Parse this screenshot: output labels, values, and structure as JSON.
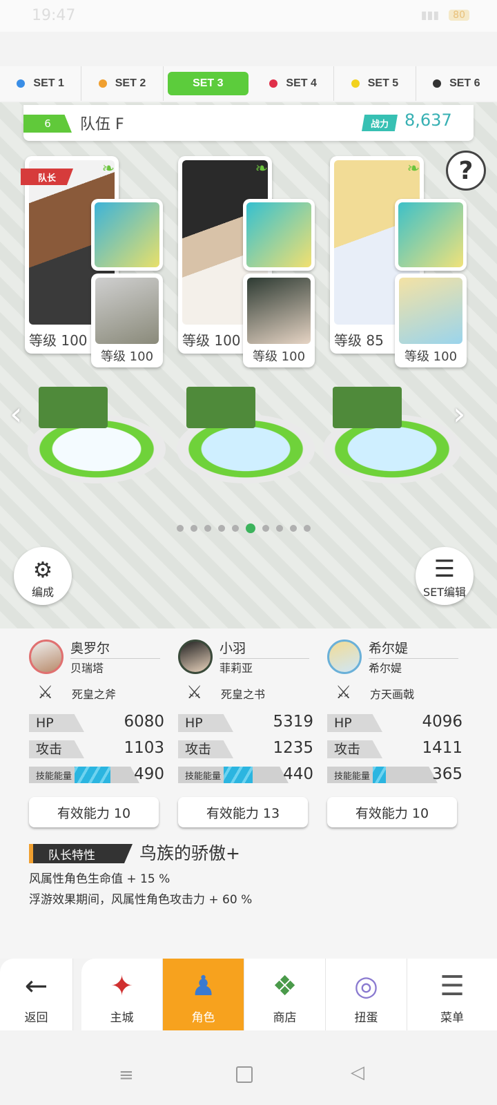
{
  "status_bar": {
    "time": "19:47",
    "battery": "80"
  },
  "set_tabs": [
    {
      "label": "SET 1",
      "color": "#3a8ee6",
      "active": false
    },
    {
      "label": "SET 2",
      "color": "#f0a030",
      "active": false
    },
    {
      "label": "SET 3",
      "color": "#5ccc3c",
      "active": true
    },
    {
      "label": "SET 4",
      "color": "#e0304a",
      "active": false
    },
    {
      "label": "SET 5",
      "color": "#f2d21e",
      "active": false
    },
    {
      "label": "SET 6",
      "color": "#333333",
      "active": false
    }
  ],
  "team": {
    "number": "6",
    "name": "队伍 F",
    "power_label": "战力",
    "power_value": "8,637"
  },
  "captain_badge": "队长",
  "help": "?",
  "slots": [
    {
      "main_level": "等级 100",
      "support_level": "等级 100"
    },
    {
      "main_level": "等级 100",
      "support_level": "等级 100"
    },
    {
      "main_level": "等级 85",
      "support_level": "等级 100"
    }
  ],
  "page_dots": {
    "count": 10,
    "active_index": 5
  },
  "formation_button": "编成",
  "set_edit_button": "SET编辑",
  "characters": [
    {
      "name": "奥罗尔",
      "support": "贝瑞塔",
      "weapon": "死皇之斧",
      "hp": "6080",
      "atk": "1103",
      "energy": "490",
      "energy_fraction": 0.55,
      "effective": "有效能力 10"
    },
    {
      "name": "小羽",
      "support": "菲莉亚",
      "weapon": "死皇之书",
      "hp": "5319",
      "atk": "1235",
      "energy": "440",
      "energy_fraction": 0.45,
      "effective": "有效能力 13"
    },
    {
      "name": "希尔媞",
      "support": "希尔媞",
      "weapon": "方天画戟",
      "hp": "4096",
      "atk": "1411",
      "energy": "365",
      "energy_fraction": 0.2,
      "effective": "有效能力 10"
    }
  ],
  "stat_labels": {
    "hp": "HP",
    "atk": "攻击",
    "energy": "技能能量"
  },
  "leader": {
    "tag": "队长特性",
    "name": "鸟族的骄傲+",
    "lines": [
      "风属性角色生命值 + 15 %",
      "浮游效果期间，风属性角色攻击力 + 60 %"
    ]
  },
  "nav": [
    {
      "label": "返回",
      "icon": "back-arrow-icon",
      "active": false
    },
    {
      "label": "主城",
      "icon": "town-icon",
      "active": false
    },
    {
      "label": "角色",
      "icon": "character-icon",
      "active": true
    },
    {
      "label": "商店",
      "icon": "shop-icon",
      "active": false
    },
    {
      "label": "扭蛋",
      "icon": "gacha-icon",
      "active": false
    },
    {
      "label": "菜单",
      "icon": "menu-icon",
      "active": false
    }
  ]
}
